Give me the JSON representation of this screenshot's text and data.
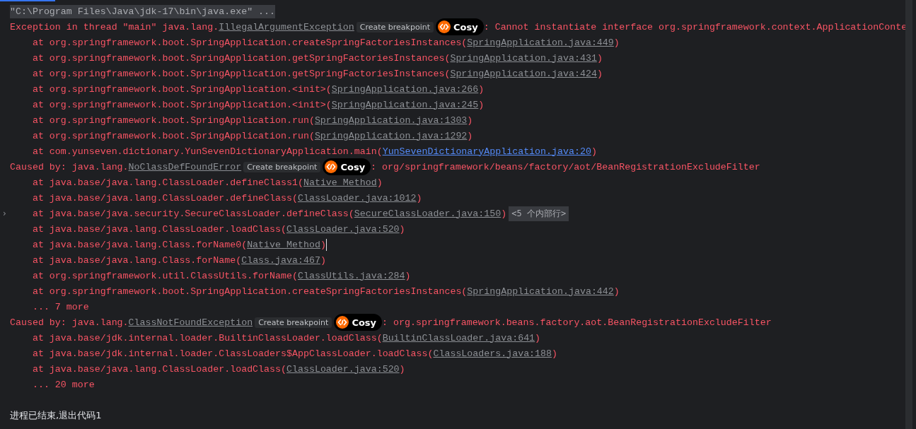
{
  "console": {
    "lines": [
      {
        "kind": "command",
        "text": "\"C:\\Program Files\\Java\\jdk-17\\bin\\java.exe\" ..."
      },
      {
        "kind": "exception",
        "prefix": "Exception in thread \"main\" java.lang.",
        "exception": "IllegalArgumentException",
        "hint": "Create breakpoint",
        "badge": "Cosy",
        "message": ": Cannot instantiate interface org.springframework.context.ApplicationConte"
      },
      {
        "kind": "frame",
        "text": "    at org.springframework.boot.SpringApplication.createSpringFactoriesInstances(",
        "link": "SpringApplication.java:449",
        "suffix": ")",
        "user_code": false
      },
      {
        "kind": "frame",
        "text": "    at org.springframework.boot.SpringApplication.getSpringFactoriesInstances(",
        "link": "SpringApplication.java:431",
        "suffix": ")",
        "user_code": false
      },
      {
        "kind": "frame",
        "text": "    at org.springframework.boot.SpringApplication.getSpringFactoriesInstances(",
        "link": "SpringApplication.java:424",
        "suffix": ")",
        "user_code": false
      },
      {
        "kind": "frame",
        "text": "    at org.springframework.boot.SpringApplication.<init>(",
        "link": "SpringApplication.java:266",
        "suffix": ")",
        "user_code": false
      },
      {
        "kind": "frame",
        "text": "    at org.springframework.boot.SpringApplication.<init>(",
        "link": "SpringApplication.java:245",
        "suffix": ")",
        "user_code": false
      },
      {
        "kind": "frame",
        "text": "    at org.springframework.boot.SpringApplication.run(",
        "link": "SpringApplication.java:1303",
        "suffix": ")",
        "user_code": false
      },
      {
        "kind": "frame",
        "text": "    at org.springframework.boot.SpringApplication.run(",
        "link": "SpringApplication.java:1292",
        "suffix": ")",
        "user_code": false
      },
      {
        "kind": "frame",
        "text": "    at com.yunseven.dictionary.YunSevenDictionaryApplication.main(",
        "link": "YunSevenDictionaryApplication.java:20",
        "suffix": ")",
        "user_code": true
      },
      {
        "kind": "exception",
        "prefix": "Caused by: java.lang.",
        "exception": "NoClassDefFoundError",
        "hint": "Create breakpoint",
        "badge": "Cosy",
        "message": ": org/springframework/beans/factory/aot/BeanRegistrationExcludeFilter"
      },
      {
        "kind": "frame",
        "text": "    at java.base/java.lang.ClassLoader.defineClass1(",
        "link": "Native Method",
        "suffix": ")",
        "user_code": false
      },
      {
        "kind": "frame",
        "text": "    at java.base/java.lang.ClassLoader.defineClass(",
        "link": "ClassLoader.java:1012",
        "suffix": ")",
        "user_code": false
      },
      {
        "kind": "frame",
        "text": "    at java.base/java.security.SecureClassLoader.defineClass(",
        "link": "SecureClassLoader.java:150",
        "suffix": ")",
        "user_code": false,
        "folded": "<5 个内部行>",
        "expander": "›"
      },
      {
        "kind": "frame",
        "text": "    at java.base/java.lang.ClassLoader.loadClass(",
        "link": "ClassLoader.java:520",
        "suffix": ")",
        "user_code": false
      },
      {
        "kind": "frame",
        "text": "    at java.base/java.lang.Class.forName0(",
        "link": "Native Method",
        "suffix": ")",
        "user_code": false,
        "caret": true
      },
      {
        "kind": "frame",
        "text": "    at java.base/java.lang.Class.forName(",
        "link": "Class.java:467",
        "suffix": ")",
        "user_code": false
      },
      {
        "kind": "frame",
        "text": "    at org.springframework.util.ClassUtils.forName(",
        "link": "ClassUtils.java:284",
        "suffix": ")",
        "user_code": false
      },
      {
        "kind": "frame",
        "text": "    at org.springframework.boot.SpringApplication.createSpringFactoriesInstances(",
        "link": "SpringApplication.java:442",
        "suffix": ")",
        "user_code": false
      },
      {
        "kind": "more",
        "text": "    ... 7 more"
      },
      {
        "kind": "exception",
        "prefix": "Caused by: java.lang.",
        "exception": "ClassNotFoundException",
        "hint": "Create breakpoint",
        "badge": "Cosy",
        "message": ": org.springframework.beans.factory.aot.BeanRegistrationExcludeFilter"
      },
      {
        "kind": "frame",
        "text": "    at java.base/jdk.internal.loader.BuiltinClassLoader.loadClass(",
        "link": "BuiltinClassLoader.java:641",
        "suffix": ")",
        "user_code": false
      },
      {
        "kind": "frame",
        "text": "    at java.base/jdk.internal.loader.ClassLoaders$AppClassLoader.loadClass(",
        "link": "ClassLoaders.java:188",
        "suffix": ")",
        "user_code": false
      },
      {
        "kind": "frame",
        "text": "    at java.base/java.lang.ClassLoader.loadClass(",
        "link": "ClassLoader.java:520",
        "suffix": ")",
        "user_code": false
      },
      {
        "kind": "more",
        "text": "    ... 20 more"
      },
      {
        "kind": "blank"
      },
      {
        "kind": "exit",
        "text": "进程已结束,退出代码1"
      }
    ]
  }
}
